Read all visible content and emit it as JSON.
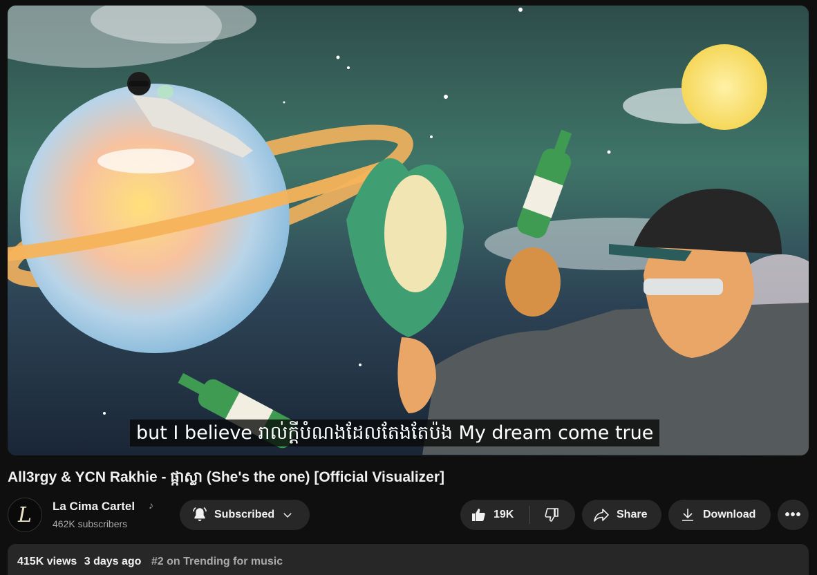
{
  "video": {
    "subtitle": "but I believe រាល់ក្តីបំណងដែលតែងតែប៉ង My dream come true",
    "title": "All3rgy & YCN Rakhie - ផ្កាស្លា (She's the one) [Official Visualizer]"
  },
  "channel": {
    "avatar_letter": "L",
    "name": "La Cima Cartel",
    "badge_icon": "music-note-icon",
    "subscribers": "462K subscribers"
  },
  "actions": {
    "subscribed_label": "Subscribed",
    "like_count": "19K",
    "share_label": "Share",
    "download_label": "Download",
    "more_label": "•••"
  },
  "description": {
    "views": "415K views",
    "age": "3 days ago",
    "trending": "#2 on Trending for music"
  },
  "colors": {
    "background": "#0f0f0f",
    "button_bg": "#272727",
    "text_primary": "#f1f1f1",
    "text_secondary": "#aaaaaa"
  }
}
